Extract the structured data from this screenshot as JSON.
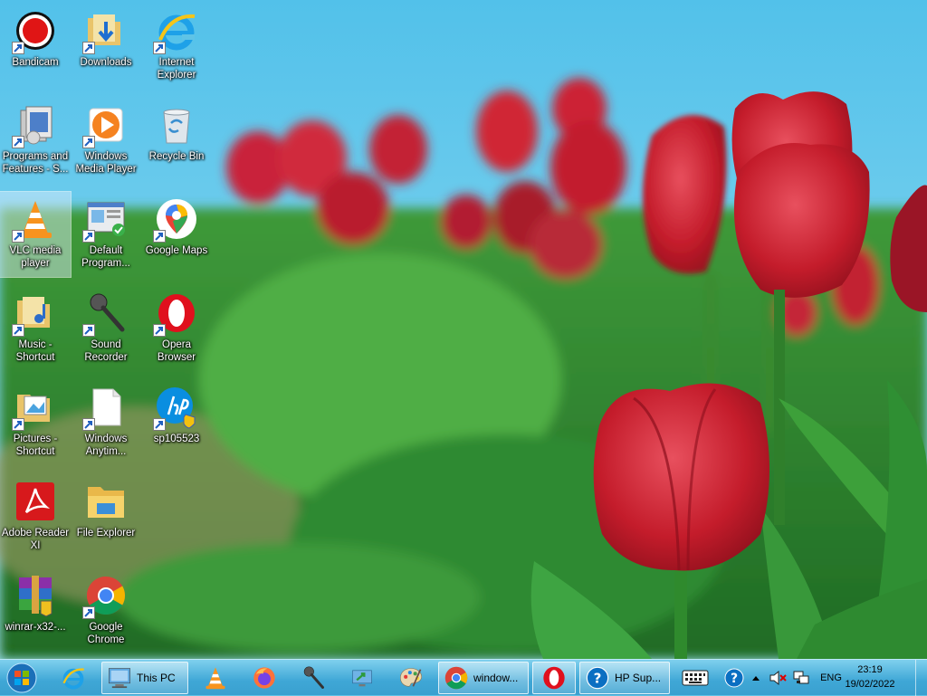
{
  "desktop": {
    "icons": [
      {
        "label": "Bandicam",
        "icon": "bandicam-icon"
      },
      {
        "label": "Downloads",
        "icon": "downloads-folder-icon"
      },
      {
        "label": "Internet\nExplorer",
        "icon": "internet-explorer-icon"
      },
      {
        "label": "Programs and\nFeatures - S...",
        "icon": "programs-features-icon"
      },
      {
        "label": "Windows\nMedia Player",
        "icon": "windows-media-player-icon"
      },
      {
        "label": "Recycle Bin",
        "icon": "recycle-bin-icon"
      },
      {
        "label": "VLC media\nplayer",
        "icon": "vlc-icon"
      },
      {
        "label": "Default\nProgram...",
        "icon": "default-programs-icon"
      },
      {
        "label": "Google Maps",
        "icon": "google-maps-icon"
      },
      {
        "label": "Music -\nShortcut",
        "icon": "music-folder-icon"
      },
      {
        "label": "Sound\nRecorder",
        "icon": "microphone-icon"
      },
      {
        "label": "Opera\nBrowser",
        "icon": "opera-icon"
      },
      {
        "label": "Pictures -\nShortcut",
        "icon": "pictures-folder-icon"
      },
      {
        "label": "Windows\nAnytim...",
        "icon": "document-icon"
      },
      {
        "label": "sp105523",
        "icon": "hp-icon"
      },
      {
        "label": "Adobe Reader\nXI",
        "icon": "adobe-reader-icon"
      },
      {
        "label": "File Explorer",
        "icon": "file-explorer-icon"
      },
      {
        "label": "winrar-x32-...",
        "icon": "winrar-icon"
      },
      {
        "label": "Google\nChrome",
        "icon": "chrome-icon"
      }
    ]
  },
  "taskbar": {
    "this_pc": "This PC",
    "chrome_window": "window...",
    "hp_support": "HP Sup...",
    "language": "ENG",
    "time": "23:19",
    "date": "19/02/2022"
  },
  "colors": {
    "taskbar": "#3fa7d6",
    "sky": "#5fc3e6",
    "tulip_red": "#c81e2d"
  }
}
